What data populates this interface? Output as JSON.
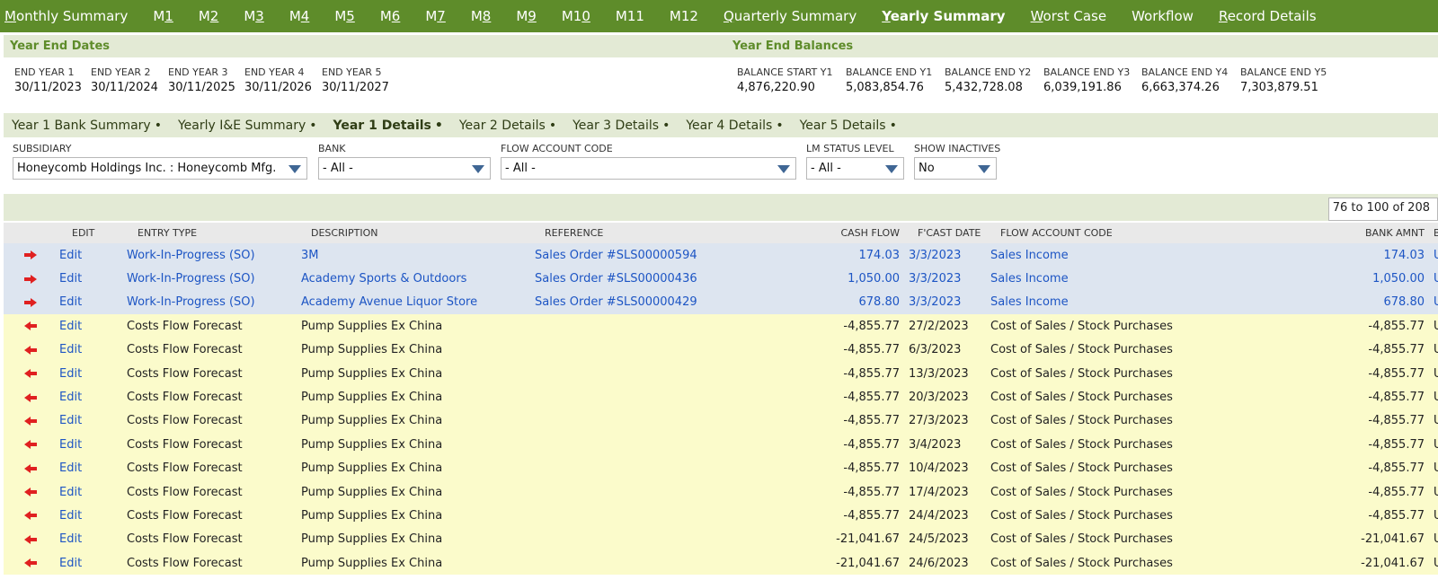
{
  "nav": {
    "tabs": [
      {
        "label": "Monthly Summary",
        "u": "M",
        "rest": "onthly Summary",
        "active": false
      },
      {
        "label": "M1",
        "pre": "M",
        "u": "1",
        "active": false
      },
      {
        "label": "M2",
        "pre": "M",
        "u": "2",
        "active": false
      },
      {
        "label": "M3",
        "pre": "M",
        "u": "3",
        "active": false
      },
      {
        "label": "M4",
        "pre": "M",
        "u": "4",
        "active": false
      },
      {
        "label": "M5",
        "pre": "M",
        "u": "5",
        "active": false
      },
      {
        "label": "M6",
        "pre": "M",
        "u": "6",
        "active": false
      },
      {
        "label": "M7",
        "pre": "M",
        "u": "7",
        "active": false
      },
      {
        "label": "M8",
        "pre": "M",
        "u": "8",
        "active": false
      },
      {
        "label": "M9",
        "pre": "M",
        "u": "9",
        "active": false
      },
      {
        "label": "M10",
        "pre": "M1",
        "u": "0",
        "active": false
      },
      {
        "label": "M11",
        "pre": "M11",
        "u": "",
        "active": false
      },
      {
        "label": "M12",
        "pre": "M12",
        "u": "",
        "active": false
      },
      {
        "label": "Quarterly Summary",
        "u": "Q",
        "rest": "uarterly Summary",
        "active": false
      },
      {
        "label": "Yearly Summary",
        "u": "Y",
        "rest": "early Summary",
        "active": true
      },
      {
        "label": "Worst Case",
        "u": "W",
        "rest": "orst Case",
        "active": false
      },
      {
        "label": "Workflow",
        "pre": "Workflow",
        "u": "",
        "active": false
      },
      {
        "label": "Record Details",
        "u": "R",
        "rest": "ecord Details",
        "active": false
      }
    ]
  },
  "year_end_dates": {
    "title": "Year End Dates",
    "items": [
      {
        "label": "END YEAR 1",
        "value": "30/11/2023"
      },
      {
        "label": "END YEAR 2",
        "value": "30/11/2024"
      },
      {
        "label": "END YEAR 3",
        "value": "30/11/2025"
      },
      {
        "label": "END YEAR 4",
        "value": "30/11/2026"
      },
      {
        "label": "END YEAR 5",
        "value": "30/11/2027"
      }
    ]
  },
  "year_end_balances": {
    "title": "Year End Balances",
    "items": [
      {
        "label": "BALANCE START Y1",
        "value": "4,876,220.90"
      },
      {
        "label": "BALANCE END Y1",
        "value": "5,083,854.76"
      },
      {
        "label": "BALANCE END Y2",
        "value": "5,432,728.08"
      },
      {
        "label": "BALANCE END Y3",
        "value": "6,039,191.86"
      },
      {
        "label": "BALANCE END Y4",
        "value": "6,663,374.26"
      },
      {
        "label": "BALANCE END Y5",
        "value": "7,303,879.51"
      }
    ]
  },
  "subtabs": [
    {
      "label": "Year 1 Bank Summary",
      "active": false
    },
    {
      "label": "Yearly I&E Summary",
      "active": false
    },
    {
      "label": "Year 1 Details",
      "active": true
    },
    {
      "label": "Year 2 Details",
      "active": false
    },
    {
      "label": "Year 3 Details",
      "active": false
    },
    {
      "label": "Year 4 Details",
      "active": false
    },
    {
      "label": "Year 5 Details",
      "active": false
    }
  ],
  "subtab_dot": "•",
  "filters": {
    "subsidiary": {
      "label": "SUBSIDIARY",
      "value": "Honeycomb Holdings Inc. : Honeycomb Mfg."
    },
    "bank": {
      "label": "BANK",
      "value": "- All -"
    },
    "flow_account_code": {
      "label": "FLOW ACCOUNT CODE",
      "value": "- All -"
    },
    "lm_status_level": {
      "label": "LM STATUS LEVEL",
      "value": "- All -"
    },
    "show_inactives": {
      "label": "SHOW INACTIVES",
      "value": "No"
    }
  },
  "pager": "76 to 100 of 208",
  "table": {
    "headers": {
      "edit": "EDIT",
      "entry_type": "ENTRY TYPE",
      "description": "DESCRIPTION",
      "reference": "REFERENCE",
      "cash_flow": "CASH FLOW",
      "fcast_date": "F'CAST DATE",
      "flow_account_code": "FLOW ACCOUNT CODE",
      "bank_amnt": "BANK AMNT",
      "bank_curr": "BANK CURR."
    },
    "rows": [
      {
        "dir": "in",
        "edit": "Edit",
        "entry_type": "Work-In-Progress (SO)",
        "description": "3M",
        "reference": "Sales Order #SLS00000594",
        "cash_flow": "174.03",
        "fcast_date": "3/3/2023",
        "flow_account_code": "Sales Income",
        "bank_amnt": "174.03",
        "bank_curr": "USA"
      },
      {
        "dir": "in",
        "edit": "Edit",
        "entry_type": "Work-In-Progress (SO)",
        "description": "Academy Sports & Outdoors",
        "reference": "Sales Order #SLS00000436",
        "cash_flow": "1,050.00",
        "fcast_date": "3/3/2023",
        "flow_account_code": "Sales Income",
        "bank_amnt": "1,050.00",
        "bank_curr": "USA"
      },
      {
        "dir": "in",
        "edit": "Edit",
        "entry_type": "Work-In-Progress (SO)",
        "description": "Academy Avenue Liquor Store",
        "reference": "Sales Order #SLS00000429",
        "cash_flow": "678.80",
        "fcast_date": "3/3/2023",
        "flow_account_code": "Sales Income",
        "bank_amnt": "678.80",
        "bank_curr": "USA"
      },
      {
        "dir": "out",
        "edit": "Edit",
        "entry_type": "Costs Flow Forecast",
        "description": "Pump Supplies Ex China",
        "reference": "",
        "cash_flow": "-4,855.77",
        "fcast_date": "27/2/2023",
        "flow_account_code": "Cost of Sales / Stock Purchases",
        "bank_amnt": "-4,855.77",
        "bank_curr": "USA"
      },
      {
        "dir": "out",
        "edit": "Edit",
        "entry_type": "Costs Flow Forecast",
        "description": "Pump Supplies Ex China",
        "reference": "",
        "cash_flow": "-4,855.77",
        "fcast_date": "6/3/2023",
        "flow_account_code": "Cost of Sales / Stock Purchases",
        "bank_amnt": "-4,855.77",
        "bank_curr": "USA"
      },
      {
        "dir": "out",
        "edit": "Edit",
        "entry_type": "Costs Flow Forecast",
        "description": "Pump Supplies Ex China",
        "reference": "",
        "cash_flow": "-4,855.77",
        "fcast_date": "13/3/2023",
        "flow_account_code": "Cost of Sales / Stock Purchases",
        "bank_amnt": "-4,855.77",
        "bank_curr": "USA"
      },
      {
        "dir": "out",
        "edit": "Edit",
        "entry_type": "Costs Flow Forecast",
        "description": "Pump Supplies Ex China",
        "reference": "",
        "cash_flow": "-4,855.77",
        "fcast_date": "20/3/2023",
        "flow_account_code": "Cost of Sales / Stock Purchases",
        "bank_amnt": "-4,855.77",
        "bank_curr": "USA"
      },
      {
        "dir": "out",
        "edit": "Edit",
        "entry_type": "Costs Flow Forecast",
        "description": "Pump Supplies Ex China",
        "reference": "",
        "cash_flow": "-4,855.77",
        "fcast_date": "27/3/2023",
        "flow_account_code": "Cost of Sales / Stock Purchases",
        "bank_amnt": "-4,855.77",
        "bank_curr": "USA"
      },
      {
        "dir": "out",
        "edit": "Edit",
        "entry_type": "Costs Flow Forecast",
        "description": "Pump Supplies Ex China",
        "reference": "",
        "cash_flow": "-4,855.77",
        "fcast_date": "3/4/2023",
        "flow_account_code": "Cost of Sales / Stock Purchases",
        "bank_amnt": "-4,855.77",
        "bank_curr": "USA"
      },
      {
        "dir": "out",
        "edit": "Edit",
        "entry_type": "Costs Flow Forecast",
        "description": "Pump Supplies Ex China",
        "reference": "",
        "cash_flow": "-4,855.77",
        "fcast_date": "10/4/2023",
        "flow_account_code": "Cost of Sales / Stock Purchases",
        "bank_amnt": "-4,855.77",
        "bank_curr": "USA"
      },
      {
        "dir": "out",
        "edit": "Edit",
        "entry_type": "Costs Flow Forecast",
        "description": "Pump Supplies Ex China",
        "reference": "",
        "cash_flow": "-4,855.77",
        "fcast_date": "17/4/2023",
        "flow_account_code": "Cost of Sales / Stock Purchases",
        "bank_amnt": "-4,855.77",
        "bank_curr": "USA"
      },
      {
        "dir": "out",
        "edit": "Edit",
        "entry_type": "Costs Flow Forecast",
        "description": "Pump Supplies Ex China",
        "reference": "",
        "cash_flow": "-4,855.77",
        "fcast_date": "24/4/2023",
        "flow_account_code": "Cost of Sales / Stock Purchases",
        "bank_amnt": "-4,855.77",
        "bank_curr": "USA"
      },
      {
        "dir": "out",
        "edit": "Edit",
        "entry_type": "Costs Flow Forecast",
        "description": "Pump Supplies Ex China",
        "reference": "",
        "cash_flow": "-21,041.67",
        "fcast_date": "24/5/2023",
        "flow_account_code": "Cost of Sales / Stock Purchases",
        "bank_amnt": "-21,041.67",
        "bank_curr": "USA"
      },
      {
        "dir": "out",
        "edit": "Edit",
        "entry_type": "Costs Flow Forecast",
        "description": "Pump Supplies Ex China",
        "reference": "",
        "cash_flow": "-21,041.67",
        "fcast_date": "24/6/2023",
        "flow_account_code": "Cost of Sales / Stock Purchases",
        "bank_amnt": "-21,041.67",
        "bank_curr": "USA"
      }
    ]
  },
  "icons": {
    "in_arrow": "arrow-right-icon",
    "out_arrow": "arrow-left-icon",
    "dropdown": "caret-down-icon"
  },
  "colors": {
    "nav_green": "#5e8c2a",
    "section_bg": "#e3ead5",
    "link_blue": "#1d55c4",
    "inflow_row": "#dde5f0",
    "outflow_row": "#fbfbcb",
    "arrow_red": "#e02020",
    "caret_blue": "#3f6694"
  }
}
